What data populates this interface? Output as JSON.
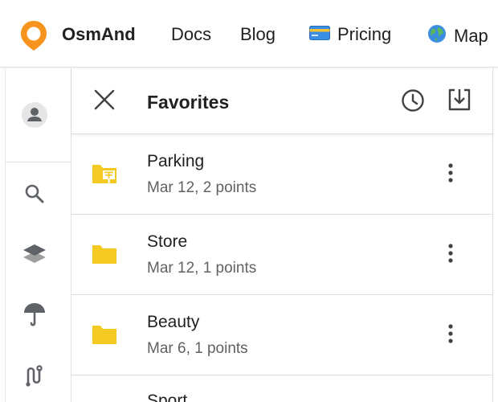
{
  "nav": {
    "brand": "OsmAnd",
    "docs": "Docs",
    "blog": "Blog",
    "pricing": "Pricing",
    "pricing_emoji": "💳",
    "map": "Map",
    "map_emoji": "🌍"
  },
  "colors": {
    "brand_orange": "#f7941d",
    "folder_yellow": "#f3c922",
    "icon_gray": "#5f6368"
  },
  "rail": {
    "items": [
      {
        "icon": "account-icon"
      },
      {
        "icon": "search-icon"
      },
      {
        "icon": "layers-icon"
      },
      {
        "icon": "weather-icon"
      },
      {
        "icon": "route-icon"
      }
    ]
  },
  "panel": {
    "title": "Favorites"
  },
  "favorites": [
    {
      "name": "Parking",
      "meta": "Mar 12, 2 points",
      "icon": "parking-folder-icon"
    },
    {
      "name": "Store",
      "meta": "Mar 12, 1 points",
      "icon": "folder-icon"
    },
    {
      "name": "Beauty",
      "meta": "Mar 6, 1 points",
      "icon": "folder-icon"
    }
  ],
  "partial_item": {
    "name": "Sport"
  }
}
